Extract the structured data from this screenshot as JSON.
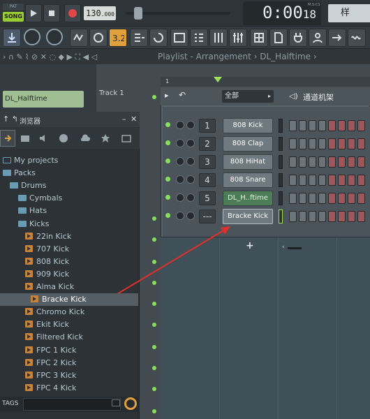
{
  "transport": {
    "pat_label": "PAT",
    "song_label": "SONG",
    "tempo_value": "130",
    "tempo_decimal": ".000",
    "time_main": "0:00",
    "time_ms": "18",
    "time_unit": "M:S:CS",
    "right_label": "样"
  },
  "playlist": {
    "title": "Playlist - Arrangement › DL_Halftime ›",
    "clip_label": "DL_Halftime",
    "track_name": "Track 1",
    "ruler_mark": "1"
  },
  "browser": {
    "title": "浏览器",
    "items": [
      {
        "label": "My projects",
        "type": "root"
      },
      {
        "label": "Packs",
        "type": "folder"
      },
      {
        "label": "Drums",
        "type": "folder"
      },
      {
        "label": "Cymbals",
        "type": "folder"
      },
      {
        "label": "Hats",
        "type": "folder"
      },
      {
        "label": "Kicks",
        "type": "folder"
      },
      {
        "label": "22in Kick",
        "type": "sample"
      },
      {
        "label": "707 Kick",
        "type": "sample"
      },
      {
        "label": "808 Kick",
        "type": "sample"
      },
      {
        "label": "909 Kick",
        "type": "sample"
      },
      {
        "label": "Alma Kick",
        "type": "sample"
      },
      {
        "label": "Bracke Kick",
        "type": "sample",
        "selected": true
      },
      {
        "label": "Chromo Kick",
        "type": "sample"
      },
      {
        "label": "Ekit Kick",
        "type": "sample"
      },
      {
        "label": "Filtered Kick",
        "type": "sample"
      },
      {
        "label": "FPC 1 Kick",
        "type": "sample"
      },
      {
        "label": "FPC 2 Kick",
        "type": "sample"
      },
      {
        "label": "FPC 3 Kick",
        "type": "sample"
      },
      {
        "label": "FPC 4 Kick",
        "type": "sample"
      }
    ],
    "tags_label": "TAGS"
  },
  "rack": {
    "filter": "全部",
    "title": "通道机架",
    "channels": [
      {
        "num": "1",
        "name": "808 Kick"
      },
      {
        "num": "2",
        "name": "808 Clap"
      },
      {
        "num": "3",
        "name": "808 HiHat"
      },
      {
        "num": "4",
        "name": "808 Snare"
      },
      {
        "num": "5",
        "name": "DL_H..ftime"
      },
      {
        "num": "---",
        "name": "Bracke Kick"
      }
    ],
    "add_label": "+"
  },
  "colors": {
    "accent_green": "#86e05a",
    "song_green": "#9acd32",
    "step_red": "#a0555b",
    "arrow_red": "#e0302a"
  }
}
